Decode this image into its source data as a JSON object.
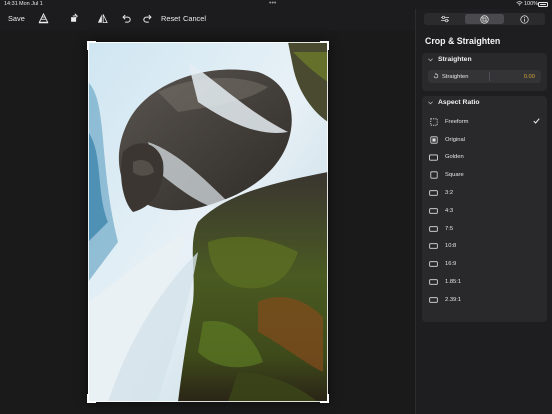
{
  "status": {
    "time": "14:31",
    "date": "Mon Jul 1",
    "dots": "•••",
    "battery_percent": "100%",
    "wifi_icon": "wifi-icon",
    "battery_icon": "battery-icon"
  },
  "toolbar": {
    "save_label": "Save",
    "reset_label": "Reset",
    "cancel_label": "Cancel",
    "icons": [
      "adjust-cone-icon",
      "crop-rotate-icon",
      "flip-icon",
      "undo-icon",
      "redo-icon"
    ]
  },
  "panel": {
    "tabs": [
      "sliders-icon",
      "crop-straighten-icon",
      "info-icon"
    ],
    "active_tab": 1,
    "title": "Crop & Straighten",
    "straighten": {
      "header": "Straighten",
      "slider_label": "Straighten",
      "value": "0.00"
    },
    "aspect_ratio": {
      "header": "Aspect Ratio",
      "selected": 0,
      "items": [
        {
          "label": "Freeform",
          "icon": "freeform-icon"
        },
        {
          "label": "Original",
          "icon": "original-icon"
        },
        {
          "label": "Golden",
          "icon": "golden-icon"
        },
        {
          "label": "Square",
          "icon": "square-icon"
        },
        {
          "label": "3:2",
          "icon": "ratio-icon"
        },
        {
          "label": "4:3",
          "icon": "ratio-icon"
        },
        {
          "label": "7:5",
          "icon": "ratio-icon"
        },
        {
          "label": "10:8",
          "icon": "ratio-icon"
        },
        {
          "label": "16:9",
          "icon": "ratio-icon"
        },
        {
          "label": "1.85:1",
          "icon": "ratio-icon"
        },
        {
          "label": "2.39:1",
          "icon": "ratio-icon"
        }
      ]
    }
  },
  "colors": {
    "accent": "#d4a437",
    "background": "#1c1c1e",
    "panel": "#1e1e20",
    "card": "#29292c"
  }
}
